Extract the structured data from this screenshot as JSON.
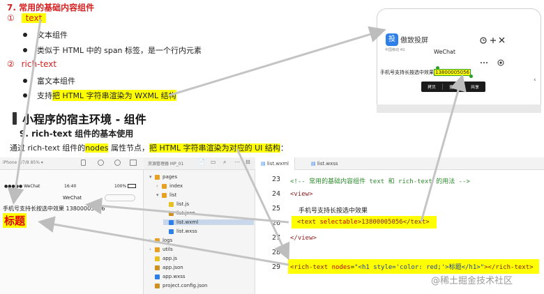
{
  "slide": {
    "heading7": "7. 常用的基础内容组件",
    "item1": {
      "num": "①",
      "label": "text"
    },
    "bullets1": [
      "文本组件",
      "类似于 HTML 中的 span 标签，是一个行内元素"
    ],
    "item2": {
      "num": "②",
      "label": "rich-text"
    },
    "bullet2a": "富文本组件",
    "bullet2b": {
      "pre": "支持",
      "hl": "把 HTML 字符串渲染为 WXML 结构"
    },
    "section": "小程序的宿主环境 - 组件",
    "sub": "9. rich-text 组件的基本使用",
    "desc": {
      "pre": "通过 rich-text 组件的",
      "hl1": "nodes",
      "mid": " 属性节点，",
      "hl2": "把 HTML 字符串渲染为对应的 UI 结构",
      "post": "："
    }
  },
  "phone": {
    "app_icon": "投",
    "app_name": "傲致投屏",
    "status": "中国移动 4G",
    "title": "WeChat",
    "text_prefix": "手机号支持长按选中效果",
    "text_selected": "13800005056",
    "menu": [
      "拷贝",
      "查询",
      "共享"
    ],
    "top_icons": [
      "history-icon",
      "settings-icon",
      "close-icon"
    ],
    "nav_icons": [
      "more-icon",
      "record-icon"
    ]
  },
  "devtools": {
    "sim_toolbar": "iPhone 6/7/8 85% ▾",
    "sim_status_left": "●●●●● WeChat",
    "sim_status_time": "16:40",
    "sim_status_right": "100%",
    "sim_title": "WeChat",
    "sim_text": "手机号支持长按选中效果 13800005056",
    "sim_heading": "标题",
    "tree_toolbar": "资源管理器 MP_01",
    "files": [
      {
        "label": "pages",
        "indent": 0,
        "kind": "folder",
        "arrow": "▾"
      },
      {
        "label": "index",
        "indent": 1,
        "kind": "folder",
        "arrow": "›"
      },
      {
        "label": "list",
        "indent": 1,
        "kind": "folder",
        "arrow": "▾"
      },
      {
        "label": "list.js",
        "indent": 2,
        "kind": "js",
        "arrow": ""
      },
      {
        "label": "list.json",
        "indent": 2,
        "kind": "json",
        "arrow": ""
      },
      {
        "label": "list.wxml",
        "indent": 2,
        "kind": "wxml",
        "arrow": "",
        "active": true
      },
      {
        "label": "list.wxss",
        "indent": 2,
        "kind": "wxss",
        "arrow": ""
      },
      {
        "label": "logs",
        "indent": 0,
        "kind": "folder",
        "arrow": "›"
      },
      {
        "label": "utils",
        "indent": 0,
        "kind": "folder",
        "arrow": "›"
      },
      {
        "label": "app.js",
        "indent": 0,
        "kind": "js",
        "arrow": ""
      },
      {
        "label": "app.json",
        "indent": 0,
        "kind": "json",
        "arrow": ""
      },
      {
        "label": "app.wxss",
        "indent": 0,
        "kind": "wxss",
        "arrow": ""
      },
      {
        "label": "project.config.json",
        "indent": 0,
        "kind": "json",
        "arrow": ""
      }
    ],
    "tabs": [
      "list.wxml",
      "list.wxss"
    ],
    "line_numbers": [
      "23",
      "24",
      "25",
      "26",
      "27",
      "28",
      "29"
    ],
    "code": {
      "l23": "<!-- 常用的基础内容组件 text 和 rich-text 的用法 -->",
      "l24": "<view>",
      "l25": "手机号支持长按选中效果",
      "l26_open": "<text",
      "l26_attr": " selectable",
      "l26_rest": ">13800005056</text>",
      "l27": "</view>",
      "l29_open": "<rich-text",
      "l29_attr": " nodes",
      "l29_eq": "=",
      "l29_str": "\"<h1 style='color: red;'>标题</h1>\"",
      "l29_close": "></rich-text>"
    },
    "watermark": "@稀土掘金技术社区"
  },
  "colors": {
    "highlight": "#ffff00",
    "accent_red": "#d42020",
    "arrow": "#b9b9b9"
  }
}
